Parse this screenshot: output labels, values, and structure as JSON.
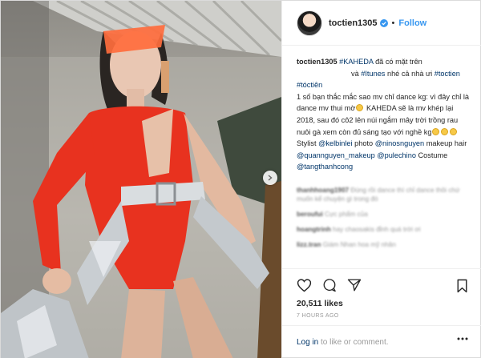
{
  "post": {
    "username": "toctien1305",
    "follow_label": "Follow",
    "separator": "•",
    "views": "20,511 likes",
    "time_ago": "7 HOURS AGO",
    "login_link": "Log in",
    "login_text": " to like or comment."
  },
  "caption": {
    "username": "toctien1305",
    "parts": [
      {
        "t": "#KAHEDA",
        "tag": true
      },
      {
        "t": " đã có mặt trên ",
        "tag": false
      },
      {
        "t": "và ",
        "tag": false
      },
      {
        "t": "#Itunes",
        "tag": true
      },
      {
        "t": " nhé cả nhà ưi ",
        "tag": false
      },
      {
        "t": "#toctien",
        "tag": true
      },
      {
        "t": "#tóctiên",
        "tag": true
      }
    ],
    "line2": "1 số bạn thắc mắc sao mv chỉ dance kg: vì đây chỉ là dance mv thui mờ",
    "line3a": " KAHEDA sẽ là mv khép lại 2018, sau đó cô2 lên núi ngắm mây trời trồng rau nuôi gà xem còn đủ sáng tạo với nghề kg",
    "line3b": " Stylist ",
    "m1": "@kelbinlei",
    "line4": " photo ",
    "m2": "@ninosnguyen",
    "line5": " makeup hair ",
    "m3": "@quannguyen_makeup",
    "m4": "@pulechino",
    "line6": " Costume ",
    "m5": "@tangthanhcong"
  },
  "comments": [
    {
      "user": "thanhhoang1907",
      "text": "Đúng rồi dance thì chỉ dance thôi chứ muốn kể chuyện gì trong đó",
      "meta": ""
    },
    {
      "user": "beroufui",
      "text": "Cực phẩm của ",
      "meta": ""
    },
    {
      "user": "hoangtrinh",
      "text": "hay chaosakis đỉnh quá trời ơi",
      "meta": ""
    },
    {
      "user": "lizz.tran",
      "text": "Giám Nhan hoa mỹ nhân",
      "meta": ""
    }
  ],
  "colors": {
    "accent": "#3897f0",
    "hashtag": "#003569",
    "border": "#efefef"
  },
  "icons": [
    "verified-icon",
    "heart-icon",
    "comment-icon",
    "share-icon",
    "bookmark-icon",
    "more-icon",
    "chevron-right-icon"
  ]
}
